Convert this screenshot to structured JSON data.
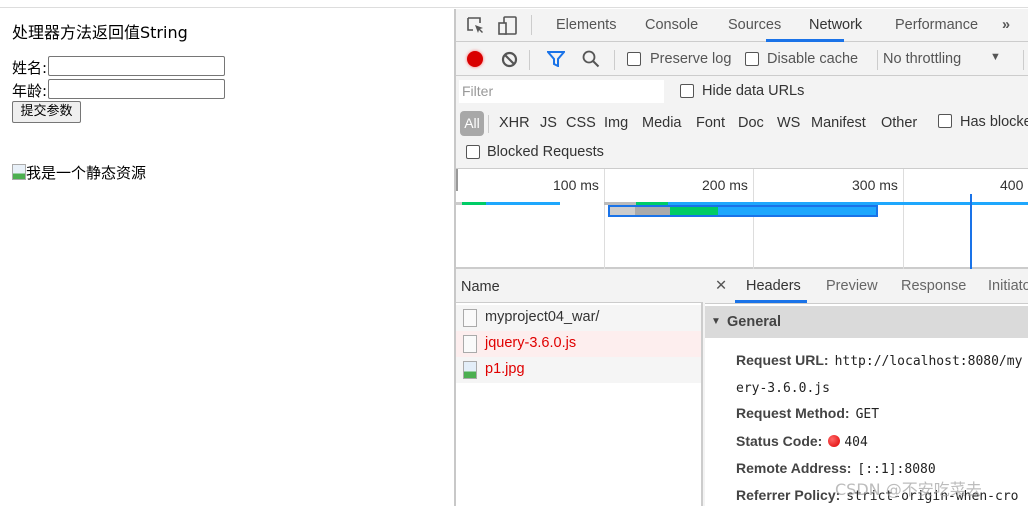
{
  "page": {
    "heading": "处理器方法返回值String",
    "name_label": "姓名:",
    "age_label": "年龄:",
    "name_value": "",
    "age_value": "",
    "submit_label": "提交参数",
    "image_alt": "我是一个静态资源"
  },
  "devtools": {
    "tabs": [
      "Elements",
      "Console",
      "Sources",
      "Network",
      "Performance"
    ],
    "active_tab": "Network",
    "more_icon": "»",
    "toolbar": {
      "preserve_log": "Preserve log",
      "disable_cache": "Disable cache",
      "throttling": "No throttling",
      "preserve_checked": false,
      "disable_checked": false
    },
    "filter": {
      "placeholder": "Filter",
      "hide_data_urls": "Hide data URLs"
    },
    "types": [
      "All",
      "XHR",
      "JS",
      "CSS",
      "Img",
      "Media",
      "Font",
      "Doc",
      "WS",
      "Manifest",
      "Other"
    ],
    "has_blocked": "Has blocke",
    "blocked_requests": "Blocked Requests",
    "timeline_ticks": [
      "100 ms",
      "200 ms",
      "300 ms",
      "400"
    ],
    "name_header": "Name",
    "requests": [
      {
        "name": "myproject04_war/",
        "status": "ok",
        "icon": "document-icon"
      },
      {
        "name": "jquery-3.6.0.js",
        "status": "error",
        "icon": "document-icon"
      },
      {
        "name": "p1.jpg",
        "status": "error",
        "icon": "image-icon"
      }
    ],
    "detail_tabs": [
      "Headers",
      "Preview",
      "Response",
      "Initiato"
    ],
    "general_label": "General",
    "general": {
      "url_key": "Request URL:",
      "url_value": "http://localhost:8080/my",
      "url_cont": "ery-3.6.0.js",
      "method_key": "Request Method:",
      "method_value": "GET",
      "status_key": "Status Code:",
      "status_value": "404",
      "remote_key": "Remote Address:",
      "remote_value": "[::1]:8080",
      "referrer_key": "Referrer Policy:",
      "referrer_value": "strict-origin-when-cro"
    },
    "colors": {
      "accent": "#1a73e8",
      "error": "#e00000",
      "record": "#d90000"
    }
  },
  "watermark": "CSDN @不安吃菜去"
}
